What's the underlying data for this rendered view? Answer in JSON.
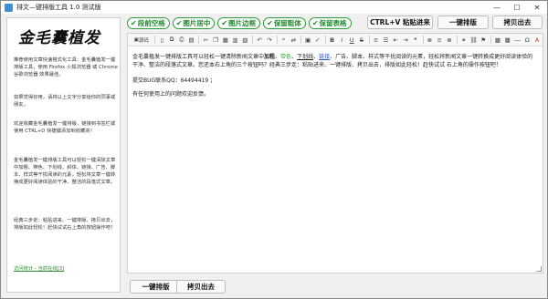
{
  "window": {
    "title": "排文—键排版工具 1.0 测试版",
    "minimize": "—",
    "maximize": "☐",
    "close": "✕"
  },
  "sidebar": {
    "logo_text": "金毛囊植发",
    "paragraphs": [
      "推荐使用文章快速格式化工具：金毛囊植发一键排版工具，使用 Firefox 火狐浏览器 或 Chrome 谷歌浏览器 效果最佳。",
      "如果觉得好用，请将以上文字分享给你的同事或朋友。",
      "欢迎收藏金毛囊植发一键排版，链接到书签栏或使用 CTRL+D 快捷键添加到收藏夹！",
      "金毛囊植发一键排版工具可以轻松一键清除文章中加粗、带色、下划线、斜体、链接、广告、脚本、样式等干扰阅读的元素，轻松将文章一键转换成更好阅读体验的干净、整洁的段落式文章。",
      "经典三步走：粘贴进来、一键排版、拷贝出去，排版如此轻松！赶快试试右上角的按钮操作吧！"
    ],
    "link_text": "访问统计 - 当前在线[3]"
  },
  "topbar": {
    "checks": [
      "段前空格",
      "图片居中",
      "图片边框",
      "保留粗体",
      "保留表格"
    ],
    "paste_button": "CTRL+V 粘贴进来",
    "format_button": "一键排版",
    "copy_button": "拷贝出去"
  },
  "toolbar": {
    "source_label": "源码"
  },
  "editor": {
    "para1_a": "金毛囊植发一键排版工具可以轻松一键清除新闻文章中",
    "para1_bold": "加粗",
    "para1_sep1": "、",
    "para1_green": "带色",
    "para1_sep2": "、",
    "para1_under": "下划线",
    "para1_sep3": "、",
    "para1_link": "链接",
    "para1_b": "、广告、脚本、样式等干扰阅读的元素，轻松将新闻文章一键转换成更好阅读体验的干净、整洁的段落式文章。您还本右上角的三个按钮吗？经典三步走：粘贴进来、一键排版、拷贝出去，排版如此轻松！赶快试试 右上角的操作按钮吧！",
    "para2": "提交BUG联系QQ：64494419 ；",
    "para3": "有任何使用上的问题欢迎反馈。"
  },
  "bottom": {
    "format_button": "一键排版",
    "copy_button": "拷贝出去"
  }
}
